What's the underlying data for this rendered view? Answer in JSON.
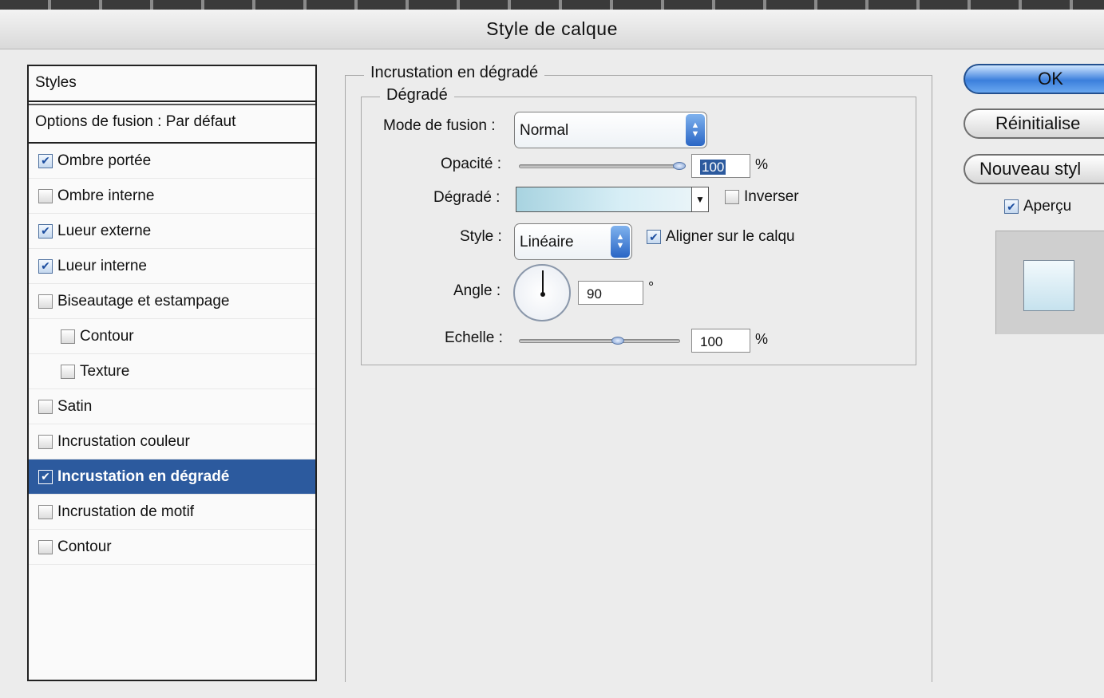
{
  "window": {
    "title": "Style de calque"
  },
  "styles_panel": {
    "header": "Styles",
    "fusion_options": "Options de fusion : Par défaut",
    "items": [
      {
        "label": "Ombre portée",
        "checked": true,
        "indent": false,
        "selected": false
      },
      {
        "label": "Ombre interne",
        "checked": false,
        "indent": false,
        "selected": false
      },
      {
        "label": "Lueur externe",
        "checked": true,
        "indent": false,
        "selected": false
      },
      {
        "label": "Lueur interne",
        "checked": true,
        "indent": false,
        "selected": false
      },
      {
        "label": "Biseautage et estampage",
        "checked": false,
        "indent": false,
        "selected": false
      },
      {
        "label": "Contour",
        "checked": false,
        "indent": true,
        "selected": false
      },
      {
        "label": "Texture",
        "checked": false,
        "indent": true,
        "selected": false
      },
      {
        "label": "Satin",
        "checked": false,
        "indent": false,
        "selected": false
      },
      {
        "label": "Incrustation couleur",
        "checked": false,
        "indent": false,
        "selected": false
      },
      {
        "label": "Incrustation en dégradé",
        "checked": true,
        "indent": false,
        "selected": true
      },
      {
        "label": "Incrustation de motif",
        "checked": false,
        "indent": false,
        "selected": false
      },
      {
        "label": "Contour",
        "checked": false,
        "indent": false,
        "selected": false
      }
    ]
  },
  "gradient_overlay": {
    "group_title": "Incrustation en dégradé",
    "subgroup_title": "Dégradé",
    "blend_mode": {
      "label": "Mode de fusion :",
      "value": "Normal"
    },
    "opacity": {
      "label": "Opacité :",
      "value": "100",
      "unit": "%",
      "level": 1.0
    },
    "gradient": {
      "label": "Dégradé :",
      "reverse_label": "Inverser",
      "reverse_checked": false
    },
    "style": {
      "label": "Style :",
      "value": "Linéaire",
      "align_label": "Aligner sur le calqu",
      "align_checked": true
    },
    "angle": {
      "label": "Angle :",
      "value": "90",
      "unit": "°"
    },
    "scale": {
      "label": "Echelle :",
      "value": "100",
      "unit": "%",
      "level": 0.62
    }
  },
  "buttons": {
    "ok": "OK",
    "reset": "Réinitialise",
    "new_style": "Nouveau styl",
    "preview_label": "Aperçu",
    "preview_checked": true
  },
  "colors": {
    "selection": "#2c5a9e",
    "ok_button": "#3b7fdc",
    "gradient_start": "#a8d3e0",
    "gradient_end": "#e9f4f8"
  }
}
